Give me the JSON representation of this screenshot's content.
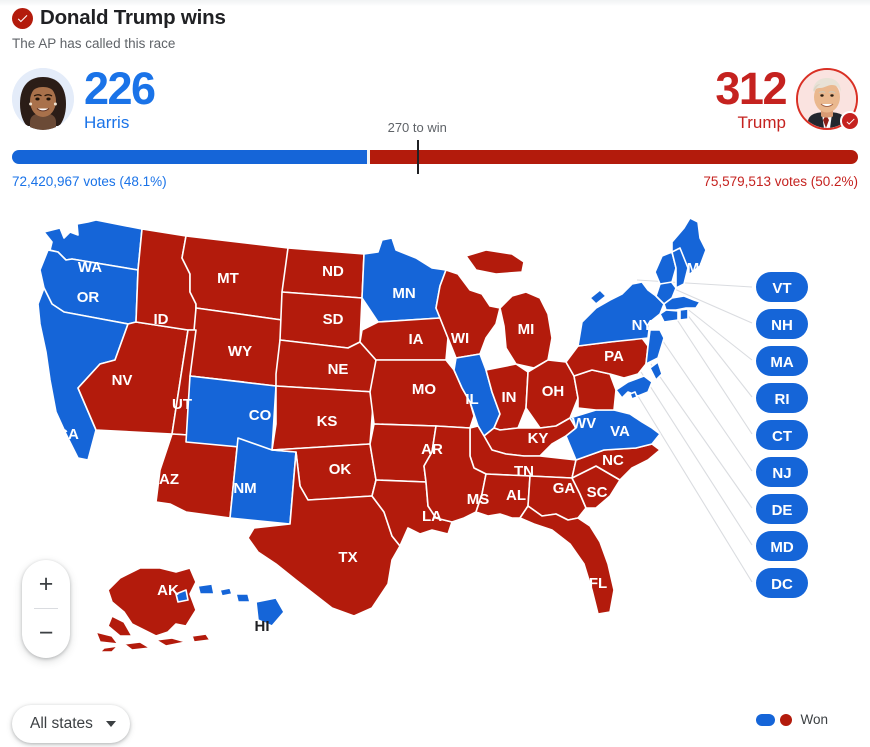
{
  "header": {
    "winner_title": "Donald Trump wins",
    "subtitle": "The AP has called this race",
    "check_icon": "check-circle-icon"
  },
  "candidates": {
    "left": {
      "name": "Harris",
      "electoral_votes": "226",
      "votes_text": "72,420,967 votes (48.1%)",
      "color": "#1A73E8",
      "avatar": "harris-avatar",
      "is_winner": false
    },
    "right": {
      "name": "Trump",
      "electoral_votes": "312",
      "votes_text": "75,579,513 votes (50.2%)",
      "color": "#C5221F",
      "avatar": "trump-avatar",
      "is_winner": true
    }
  },
  "progress": {
    "to_win_label": "270 to win",
    "threshold": 270,
    "total_electoral": 538,
    "blue_pct": 42.0,
    "red_pct": 58.0,
    "tick_pct": 47.9,
    "blue_color": "#1565D8",
    "red_color": "#B31B0C"
  },
  "map": {
    "blue_color": "#1565D8",
    "red_color": "#B31B0C",
    "states": [
      {
        "code": "WA",
        "winner": "blue"
      },
      {
        "code": "OR",
        "winner": "blue"
      },
      {
        "code": "CA",
        "winner": "blue"
      },
      {
        "code": "NV",
        "winner": "red"
      },
      {
        "code": "ID",
        "winner": "red"
      },
      {
        "code": "MT",
        "winner": "red"
      },
      {
        "code": "WY",
        "winner": "red"
      },
      {
        "code": "UT",
        "winner": "red"
      },
      {
        "code": "AZ",
        "winner": "red"
      },
      {
        "code": "CO",
        "winner": "blue"
      },
      {
        "code": "NM",
        "winner": "blue"
      },
      {
        "code": "ND",
        "winner": "red"
      },
      {
        "code": "SD",
        "winner": "red"
      },
      {
        "code": "NE",
        "winner": "red"
      },
      {
        "code": "KS",
        "winner": "red"
      },
      {
        "code": "OK",
        "winner": "red"
      },
      {
        "code": "TX",
        "winner": "red"
      },
      {
        "code": "MN",
        "winner": "blue"
      },
      {
        "code": "IA",
        "winner": "red"
      },
      {
        "code": "MO",
        "winner": "red"
      },
      {
        "code": "AR",
        "winner": "red"
      },
      {
        "code": "LA",
        "winner": "red"
      },
      {
        "code": "WI",
        "winner": "red"
      },
      {
        "code": "IL",
        "winner": "blue"
      },
      {
        "code": "MI",
        "winner": "red"
      },
      {
        "code": "IN",
        "winner": "red"
      },
      {
        "code": "OH",
        "winner": "red"
      },
      {
        "code": "KY",
        "winner": "red"
      },
      {
        "code": "TN",
        "winner": "red"
      },
      {
        "code": "MS",
        "winner": "red"
      },
      {
        "code": "AL",
        "winner": "red"
      },
      {
        "code": "GA",
        "winner": "red"
      },
      {
        "code": "FL",
        "winner": "red"
      },
      {
        "code": "SC",
        "winner": "red"
      },
      {
        "code": "NC",
        "winner": "red"
      },
      {
        "code": "VA",
        "winner": "blue"
      },
      {
        "code": "WV",
        "winner": "red"
      },
      {
        "code": "PA",
        "winner": "red"
      },
      {
        "code": "NY",
        "winner": "blue"
      },
      {
        "code": "ME",
        "winner": "blue"
      },
      {
        "code": "AK",
        "winner": "red"
      },
      {
        "code": "HI",
        "winner": "blue"
      }
    ],
    "callouts": [
      {
        "code": "VT",
        "winner": "blue"
      },
      {
        "code": "NH",
        "winner": "blue"
      },
      {
        "code": "MA",
        "winner": "blue"
      },
      {
        "code": "RI",
        "winner": "blue"
      },
      {
        "code": "CT",
        "winner": "blue"
      },
      {
        "code": "NJ",
        "winner": "blue"
      },
      {
        "code": "DE",
        "winner": "blue"
      },
      {
        "code": "MD",
        "winner": "blue"
      },
      {
        "code": "DC",
        "winner": "blue"
      }
    ]
  },
  "controls": {
    "zoom_in_label": "+",
    "zoom_out_label": "−",
    "state_filter_label": "All states"
  },
  "legend": {
    "label": "Won",
    "blue_color": "#1565D8",
    "red_color": "#B31B0C"
  }
}
